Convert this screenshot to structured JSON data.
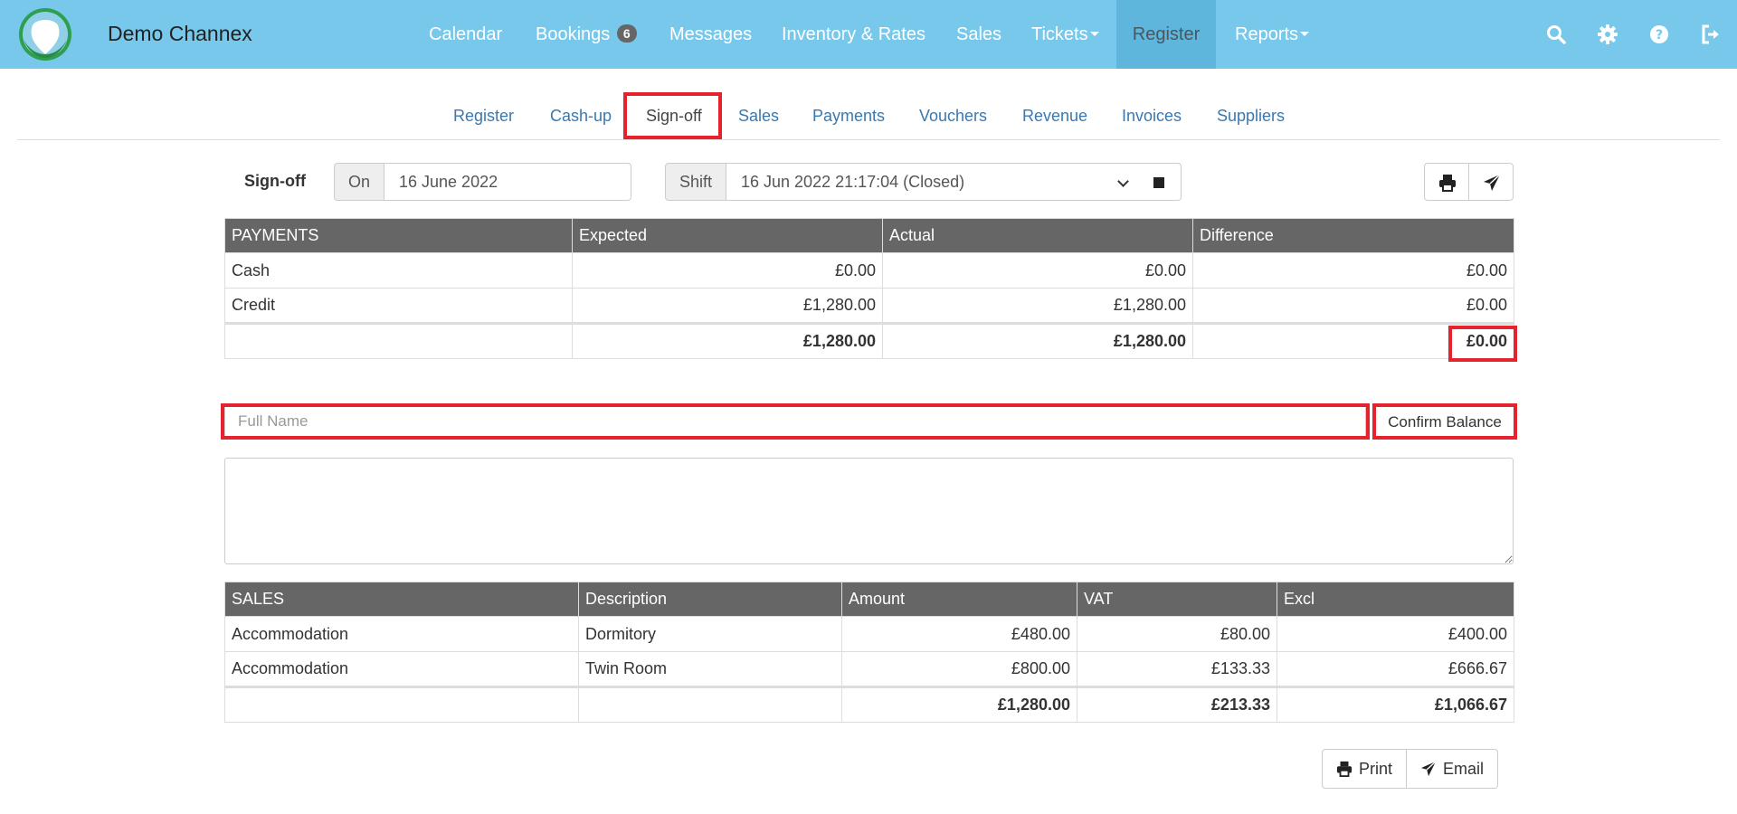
{
  "navbar": {
    "brand": "Demo Channex",
    "items": [
      {
        "label": "Calendar"
      },
      {
        "label": "Bookings",
        "badge": "6"
      },
      {
        "label": "Messages"
      },
      {
        "label": "Inventory & Rates"
      },
      {
        "label": "Sales"
      },
      {
        "label": "Tickets"
      },
      {
        "label": "Register",
        "active": true
      },
      {
        "label": "Reports"
      }
    ],
    "icons": [
      "search-icon",
      "gear-icon",
      "help-icon",
      "logout-icon"
    ],
    "colors": {
      "background": "#77c8ea",
      "active": "#5eb6dd"
    }
  },
  "subnav": {
    "tabs": [
      {
        "label": "Register"
      },
      {
        "label": "Cash-up"
      },
      {
        "label": "Sign-off",
        "active": true
      },
      {
        "label": "Sales"
      },
      {
        "label": "Payments"
      },
      {
        "label": "Vouchers"
      },
      {
        "label": "Revenue"
      },
      {
        "label": "Invoices"
      },
      {
        "label": "Suppliers"
      }
    ]
  },
  "signoff": {
    "label": "Sign-off",
    "on_label": "On",
    "date_value": "16 June 2022",
    "shift_label": "Shift",
    "shift_value": "16 Jun 2022 21:17:04 (Closed)"
  },
  "payments": {
    "headers": [
      "PAYMENTS",
      "Expected",
      "Actual",
      "Difference"
    ],
    "rows": [
      {
        "name": "Cash",
        "expected": "£0.00",
        "actual": "£0.00",
        "difference": "£0.00"
      },
      {
        "name": "Credit",
        "expected": "£1,280.00",
        "actual": "£1,280.00",
        "difference": "£0.00"
      }
    ],
    "total": {
      "expected": "£1,280.00",
      "actual": "£1,280.00",
      "difference": "£0.00"
    }
  },
  "confirm": {
    "fullname_placeholder": "Full Name",
    "confirm_label": "Confirm Balance"
  },
  "sales": {
    "headers": [
      "SALES",
      "Description",
      "Amount",
      "VAT",
      "Excl"
    ],
    "rows": [
      {
        "category": "Accommodation",
        "description": "Dormitory",
        "amount": "£480.00",
        "vat": "£80.00",
        "excl": "£400.00"
      },
      {
        "category": "Accommodation",
        "description": "Twin Room",
        "amount": "£800.00",
        "vat": "£133.33",
        "excl": "£666.67"
      }
    ],
    "total": {
      "amount": "£1,280.00",
      "vat": "£213.33",
      "excl": "£1,066.67"
    }
  },
  "actions": {
    "print_label": "Print",
    "email_label": "Email"
  },
  "highlight_color": "#e3232e"
}
